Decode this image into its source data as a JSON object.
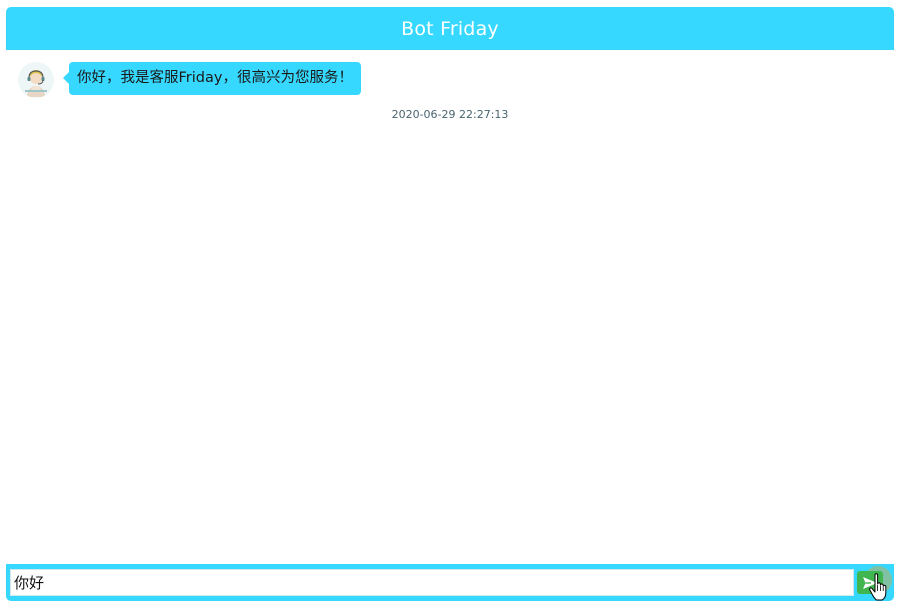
{
  "header": {
    "title": "Bot Friday"
  },
  "messages": [
    {
      "sender": "bot",
      "avatar_icon": "customer-service-avatar",
      "text": "你好，我是客服Friday，很高兴为您服务！",
      "timestamp": "2020-06-29 22:27:13"
    }
  ],
  "composer": {
    "value": "你好",
    "send_icon": "send-arrow-icon"
  },
  "colors": {
    "accent": "#36d8ff",
    "send_button": "#3fb64f"
  }
}
